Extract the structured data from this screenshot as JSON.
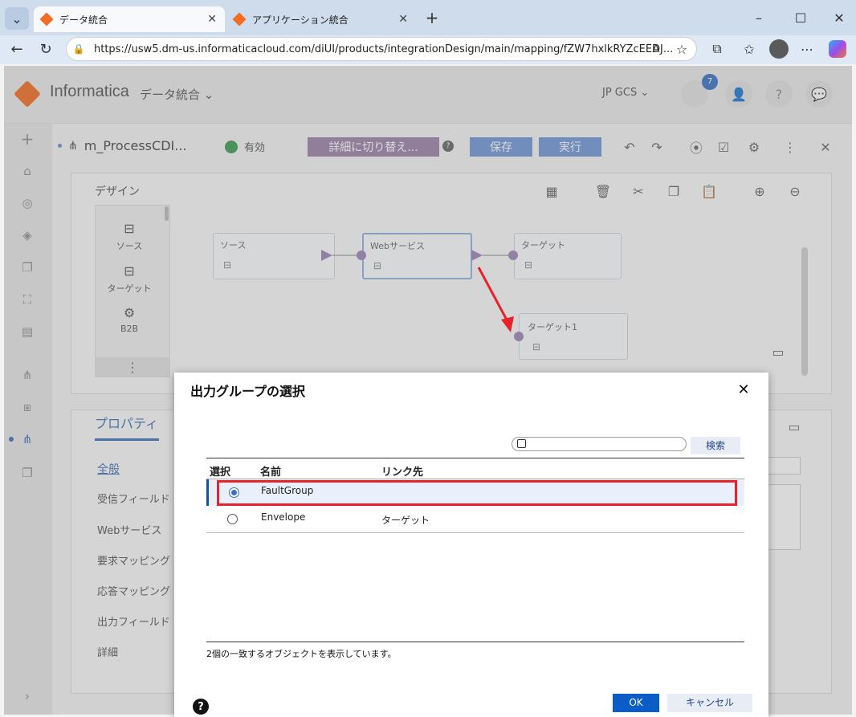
{
  "browser": {
    "tabs": [
      {
        "label": "データ統合"
      },
      {
        "label": "アプリケーション統合"
      }
    ],
    "url": "https://usw5.dm-us.informaticacloud.com/diUI/products/integrationDesign/main/mapping/fZW7hxlkRYZcEEDJ..."
  },
  "app": {
    "brand": "Informatica",
    "service": "データ統合",
    "org": "JP GCS",
    "notif_count": "7",
    "mapping_name": "m_ProcessCDI...",
    "status": "有効",
    "switch_label": "詳細に切り替え...",
    "save_label": "保存",
    "run_label": "実行",
    "design_label": "デザイン",
    "palette": [
      {
        "label": "ソース"
      },
      {
        "label": "ターゲット"
      },
      {
        "label": "B2B"
      }
    ],
    "nodes": {
      "source": "ソース",
      "ws": "Webサービス",
      "target": "ターゲット",
      "target1": "ターゲット1"
    },
    "props_tab": "プロパティ",
    "props_items": [
      "全般",
      "受信フィールド",
      "Webサービス",
      "要求マッピング",
      "応答マッピング",
      "出力フィールド",
      "詳細"
    ]
  },
  "dialog": {
    "title": "出力グループの選択",
    "search_button": "検索",
    "columns": {
      "select": "選択",
      "name": "名前",
      "link": "リンク先"
    },
    "rows": [
      {
        "name": "FaultGroup",
        "link": "",
        "selected": true
      },
      {
        "name": "Envelope",
        "link": "ターゲット",
        "selected": false
      }
    ],
    "footer_text": "2個の一致するオブジェクトを表示しています。",
    "ok_label": "OK",
    "cancel_label": "キャンセル"
  },
  "colors": {
    "accent": "#0b5cc7",
    "highlight": "#e8222a",
    "arrow": "#e8222a"
  }
}
